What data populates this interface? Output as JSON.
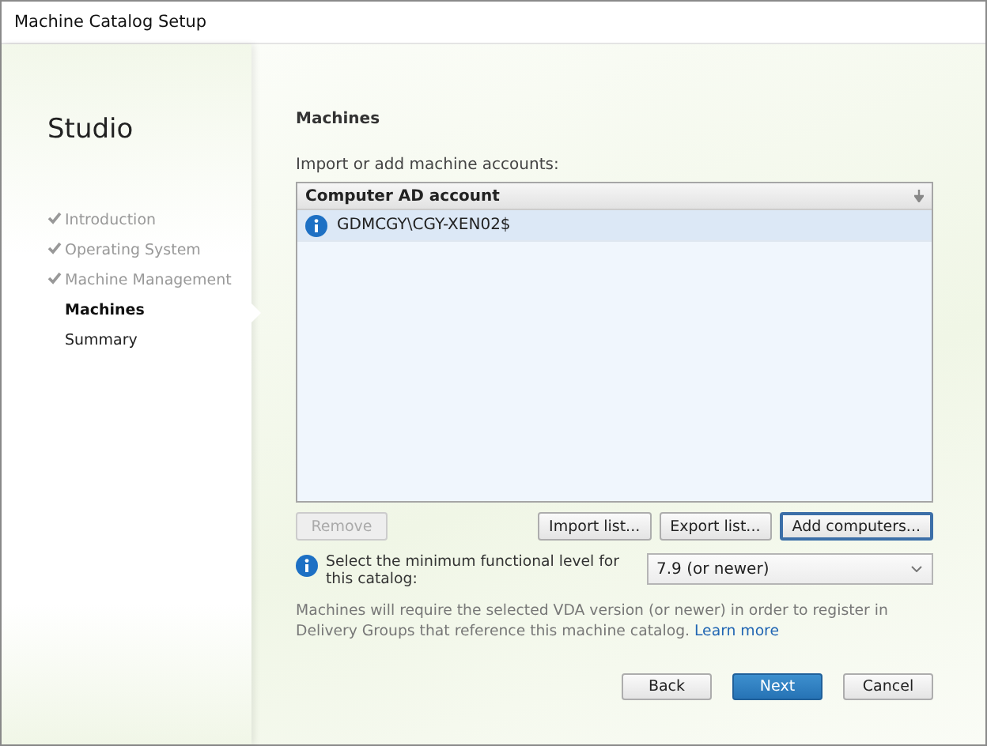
{
  "window": {
    "title": "Machine Catalog Setup"
  },
  "sidebar": {
    "brand": "Studio",
    "steps": [
      {
        "label": "Introduction",
        "done": true,
        "selected": false
      },
      {
        "label": "Operating System",
        "done": true,
        "selected": false
      },
      {
        "label": "Machine Management",
        "done": true,
        "selected": false
      },
      {
        "label": "Machines",
        "done": false,
        "selected": true
      },
      {
        "label": "Summary",
        "done": false,
        "selected": false
      }
    ]
  },
  "page": {
    "heading": "Machines",
    "instruction": "Import or add machine accounts:",
    "table": {
      "columns": [
        "Computer AD account"
      ],
      "rows": [
        {
          "account": "GDMCGY\\CGY-XEN02$",
          "selected": true
        }
      ]
    },
    "list_buttons": [
      {
        "label": "Remove",
        "disabled": true,
        "focused": false
      },
      {
        "label": "Import list...",
        "disabled": false,
        "focused": false
      },
      {
        "label": "Export list...",
        "disabled": false,
        "focused": false
      },
      {
        "label": "Add computers...",
        "disabled": false,
        "focused": true
      }
    ],
    "level_label": "Select the minimum functional level for this catalog:",
    "level_dropdown": {
      "value": "7.9 (or newer)"
    },
    "note": "Machines will require the selected VDA version (or newer) in order to register in Delivery Groups that reference this machine catalog.",
    "note_link": "Learn more"
  },
  "footer_buttons": [
    {
      "label": "Back",
      "kind": "secondary"
    },
    {
      "label": "Next",
      "kind": "primary"
    },
    {
      "label": "Cancel",
      "kind": "secondary"
    }
  ]
}
